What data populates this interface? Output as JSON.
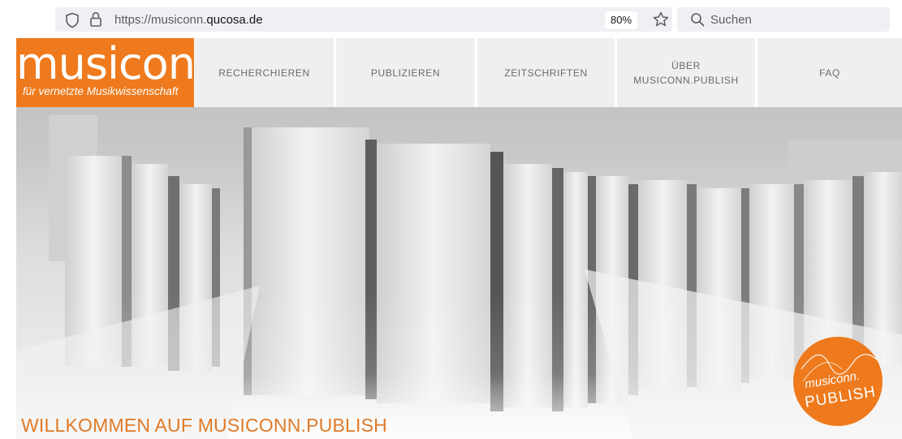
{
  "browser": {
    "url_prefix": "https://musiconn.",
    "url_domain": "qucosa.de",
    "zoom": "80%",
    "search_placeholder": "Suchen"
  },
  "site": {
    "logo_word": "musiconn",
    "logo_tagline": "für vernetzte Musikwissenschaft",
    "nav": [
      {
        "label": "RECHERCHIEREN"
      },
      {
        "label": "PUBLIZIEREN"
      },
      {
        "label": "ZEITSCHRIFTEN"
      },
      {
        "label": "ÜBER MUSICONN.PUBLISH",
        "line1": "ÜBER",
        "line2": "MUSICONN.PUBLISH"
      },
      {
        "label": "FAQ"
      }
    ],
    "welcome": "WILLKOMMEN AUF MUSICONN.PUBLISH",
    "badge_line1": "musiconn.",
    "badge_line2": "PUBLISH",
    "accent_color": "#ee7a1d"
  }
}
